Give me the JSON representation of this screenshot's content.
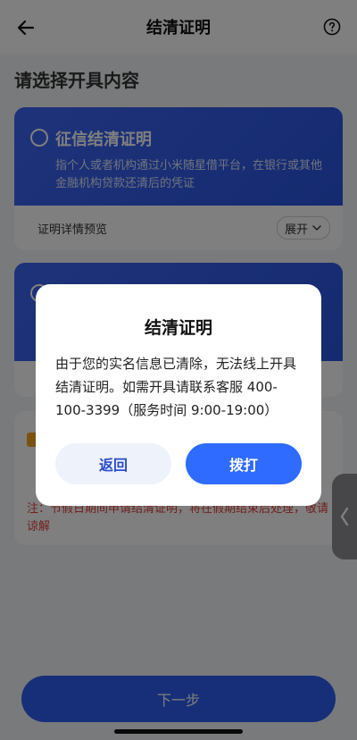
{
  "header": {
    "title": "结清证明",
    "back_icon": "arrow-left-icon",
    "help_icon": "question-circle-icon"
  },
  "page": {
    "section_title": "请选择开具内容"
  },
  "cards": [
    {
      "title": "征信结清证明",
      "description": "指个人或者机构通过小米随星借平台，在银行或其他金融机构贷款还清后的凭证",
      "preview_label": "证明详情预览",
      "expand_label": "展开"
    }
  ],
  "note": {
    "text": "注：节假日期间申请结清证明，将在假期结束后处理，敬请谅解"
  },
  "footer": {
    "next_label": "下一步"
  },
  "dialog": {
    "title": "结清证明",
    "message": "由于您的实名信息已清除，无法线上开具结清证明。如需开具请联系客服 400-100-3399（服务时间 9:00-19:00）",
    "back_label": "返回",
    "call_label": "拨打"
  },
  "colors": {
    "primary": "#2f6bff",
    "card_banner": "#3d66f4",
    "note_red": "#e0403a"
  }
}
